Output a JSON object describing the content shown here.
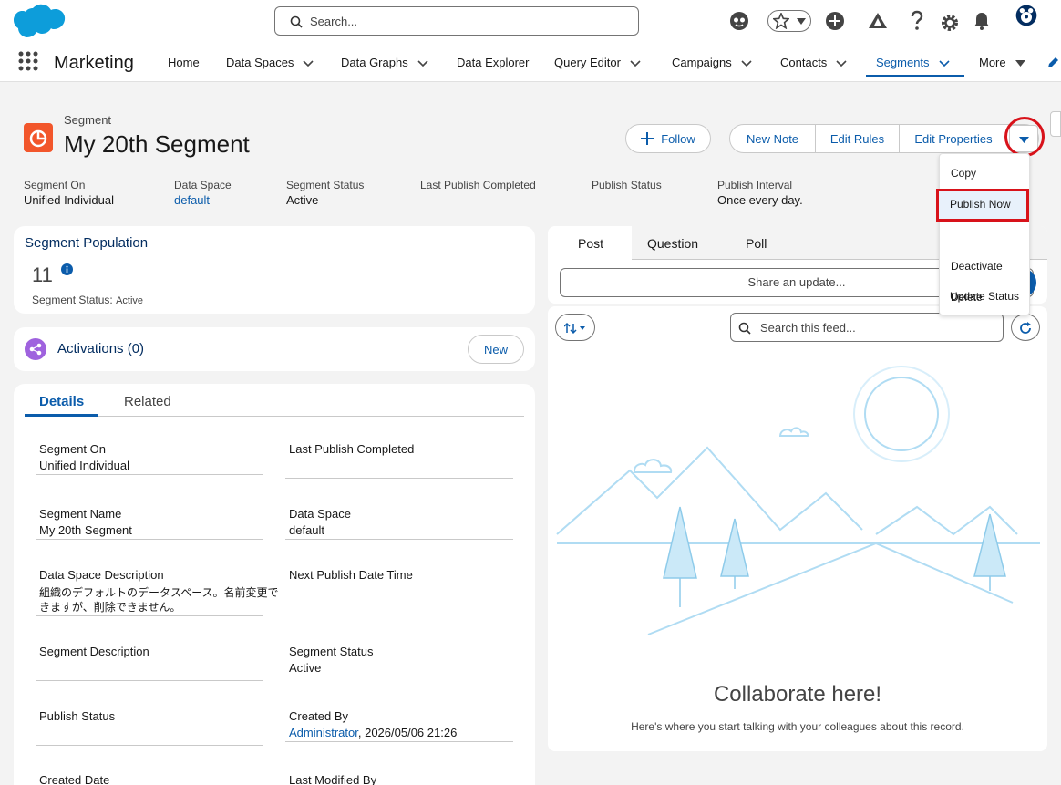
{
  "search": {
    "placeholder": "Search..."
  },
  "app": {
    "name": "Marketing"
  },
  "nav": {
    "items": [
      "Home",
      "Data Spaces",
      "Data Graphs",
      "Data Explorer",
      "Query Editor",
      "Campaigns",
      "Contacts",
      "Segments",
      "More"
    ],
    "active": "Segments"
  },
  "record": {
    "object_type": "Segment",
    "title": "My 20th Segment"
  },
  "actions": {
    "follow": "Follow",
    "new_note": "New Note",
    "edit_rules": "Edit Rules",
    "edit_properties": "Edit Properties"
  },
  "highlights": [
    {
      "label": "Segment On",
      "value": "Unified Individual"
    },
    {
      "label": "Data Space",
      "value": "default"
    },
    {
      "label": "Segment Status",
      "value": "Active"
    },
    {
      "label": "Last Publish Completed",
      "value": ""
    },
    {
      "label": "Publish Status",
      "value": ""
    },
    {
      "label": "Publish Interval",
      "value": "Once every day."
    }
  ],
  "dropdown_menu": [
    "Copy",
    "Publish Now",
    "Deactivate",
    "Delete",
    "Update Status"
  ],
  "population": {
    "title": "Segment Population",
    "count": "11",
    "status_label": "Segment Status:",
    "status_value": "Active"
  },
  "activations": {
    "title": "Activations (0)",
    "new_label": "New"
  },
  "detail_tabs": [
    "Details",
    "Related"
  ],
  "details": {
    "segment_on_label": "Segment On",
    "segment_on_value": "Unified Individual",
    "last_publish_label": "Last Publish Completed",
    "segment_name_label": "Segment Name",
    "segment_name_value": "My 20th Segment",
    "data_space_label": "Data Space",
    "data_space_value": "default",
    "ds_desc_label": "Data Space Description",
    "ds_desc_value_1": "組織のデフォルトのデータスペース。名前変更で",
    "ds_desc_value_2": "きますが、削除できません。",
    "next_publish_label": "Next Publish Date Time",
    "segment_desc_label": "Segment Description",
    "segment_status_label": "Segment Status",
    "segment_status_value": "Active",
    "publish_status_label": "Publish Status",
    "created_by_label": "Created By",
    "created_by_user": "Administrator",
    "created_by_date": ", 2026/05/06 21:26",
    "created_date_label": "Created Date",
    "last_modified_label": "Last Modified By"
  },
  "feed": {
    "tabs": [
      "Post",
      "Question",
      "Poll"
    ],
    "share_placeholder": "Share an update...",
    "search_placeholder": "Search this feed...",
    "empty_title": "Collaborate here!",
    "empty_text": "Here's where you start talking with your colleagues about this record."
  },
  "colors": {
    "brand": "#0b5cab",
    "highlight_red": "#d8121a",
    "segment_icon": "#f2562b",
    "activation_icon": "#9f62de"
  }
}
